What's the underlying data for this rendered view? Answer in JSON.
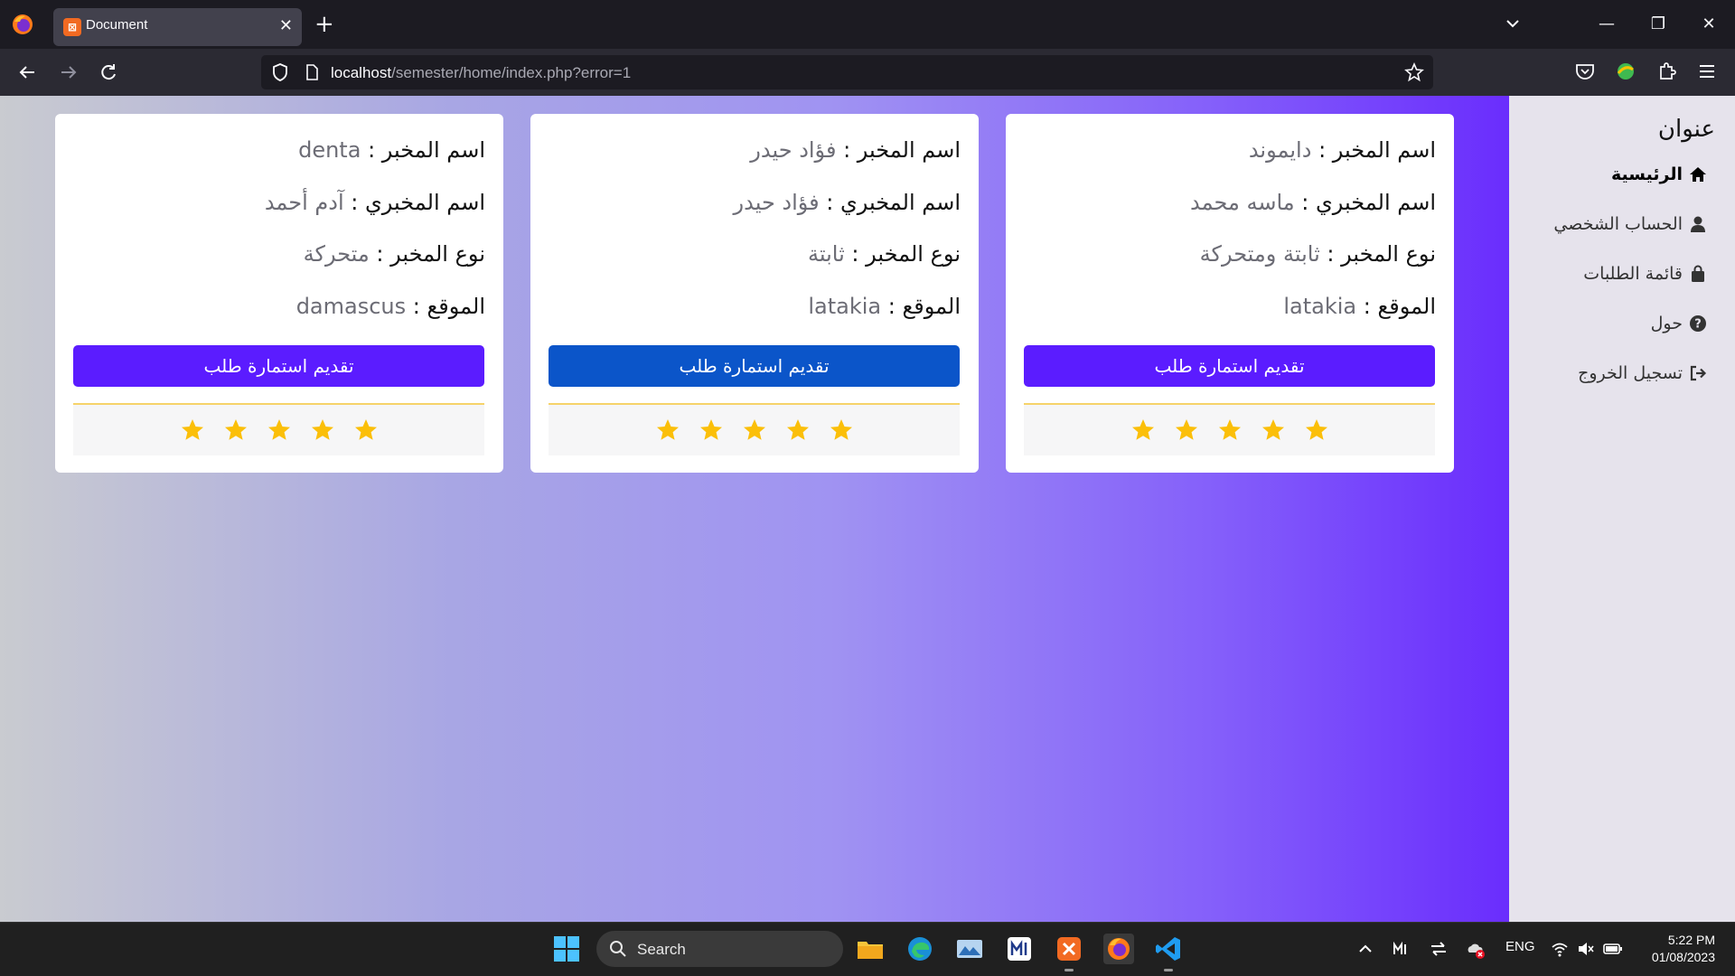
{
  "browser": {
    "tab_title": "Document",
    "tab_close": "✕",
    "new_tab": "+",
    "url_host": "localhost",
    "url_path": "/semester/home/index.php?error=1",
    "minimize": "—",
    "restore": "❐",
    "close": "✕"
  },
  "sidebar": {
    "title": "عنوان",
    "items": [
      {
        "label": "الرئيسية",
        "icon": "home-icon"
      },
      {
        "label": "الحساب الشخصي",
        "icon": "user-icon"
      },
      {
        "label": "قائمة الطلبات",
        "icon": "bag-icon"
      },
      {
        "label": "حول",
        "icon": "question-icon"
      },
      {
        "label": "تسجيل الخروج",
        "icon": "logout-icon"
      }
    ]
  },
  "cards": [
    {
      "lab_name_label": "اسم المخبر :",
      "lab_name": "دايموند",
      "technician_label": "اسم المخبري :",
      "technician": "ماسه محمد",
      "type_label": "نوع المخبر :",
      "type": "ثابتة ومتحركة",
      "location_label": "الموقع :",
      "location": "latakia",
      "button": "تقديم استمارة طلب",
      "button_color": "#5b1cff",
      "rating": 5
    },
    {
      "lab_name_label": "اسم المخبر :",
      "lab_name": "فؤاد حيدر",
      "technician_label": "اسم المخبري :",
      "technician": "فؤاد حيدر",
      "type_label": "نوع المخبر :",
      "type": "ثابتة",
      "location_label": "الموقع :",
      "location": "latakia",
      "button": "تقديم استمارة طلب",
      "button_color": "#0b55c9",
      "rating": 5
    },
    {
      "lab_name_label": "اسم المخبر :",
      "lab_name": "denta",
      "technician_label": "اسم المخبري :",
      "technician": "آدم أحمد",
      "type_label": "نوع المخبر :",
      "type": "متحركة",
      "location_label": "الموقع :",
      "location": "damascus",
      "button": "تقديم استمارة طلب",
      "button_color": "#5b1cff",
      "rating": 5
    }
  ],
  "taskbar": {
    "search_label": "Search",
    "language": "ENG",
    "time": "5:22 PM",
    "date": "01/08/2023"
  },
  "colors": {
    "star": "#fbbf09",
    "accent": "#5b1cff"
  }
}
